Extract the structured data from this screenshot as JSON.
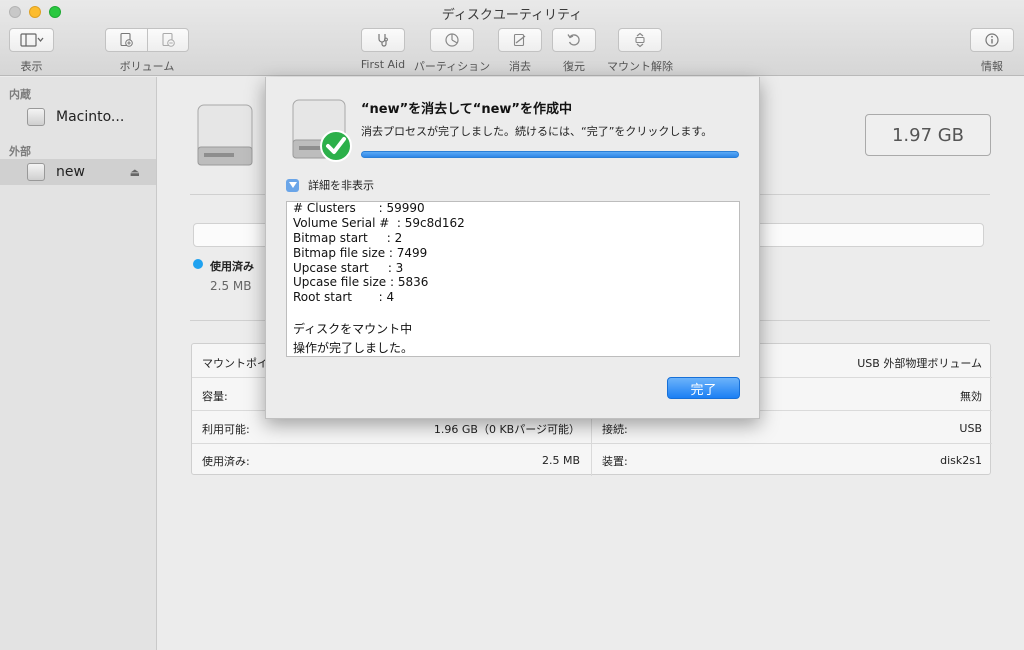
{
  "window": {
    "title": "ディスクユーティリティ"
  },
  "toolbar": {
    "view_label": "表示",
    "volume_label": "ボリューム",
    "first_aid_label": "First Aid",
    "partition_label": "パーティション",
    "erase_label": "消去",
    "restore_label": "復元",
    "unmount_label": "マウント解除",
    "info_label": "情報"
  },
  "sidebar": {
    "internal_header": "内蔵",
    "external_header": "外部",
    "items": [
      {
        "label": "Macinto..."
      },
      {
        "label": "new"
      }
    ]
  },
  "main": {
    "capacity": "1.97 GB",
    "used_label": "使用済み",
    "used_value": "2.5 MB",
    "info": {
      "mount_point_key": "マウントポイ",
      "type_value": "USB 外部物理ボリューム",
      "capacity_key": "容量:",
      "owners_value": "無効",
      "available_key": "利用可能:",
      "available_value": "1.96 GB（0 KBパージ可能）",
      "connection_key": "接続:",
      "connection_value": "USB",
      "used_key": "使用済み:",
      "used_value": "2.5 MB",
      "device_key": "装置:",
      "device_value": "disk2s1"
    }
  },
  "sheet": {
    "title": "“new”を消去して“new”を作成中",
    "message": "消去プロセスが完了しました。続けるには、“完了”をクリックします。",
    "progress": 1.0,
    "details_toggle": "詳細を非表示",
    "log_lines": [
      "# Clusters      : 59990",
      "Volume Serial #  : 59c8d162",
      "Bitmap start     : 2",
      "Bitmap file size : 7499",
      "Upcase start     : 3",
      "Upcase file size : 5836",
      "Root start       : 4",
      "",
      "ディスクをマウント中",
      "操作が完了しました。"
    ],
    "done_label": "完了"
  },
  "colors": {
    "accent": "#2f86e6",
    "used_dot": "#1fa2f0",
    "check_green": "#2cb04a"
  }
}
